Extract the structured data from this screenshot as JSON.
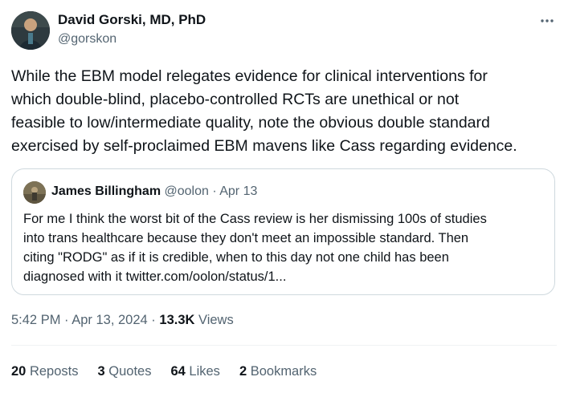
{
  "author": {
    "name": "David Gorski, MD, PhD",
    "handle": "@gorskon"
  },
  "tweet": {
    "lines": [
      "While the EBM model relegates evidence for clinical interventions for",
      "which double-blind, placebo-controlled RCTs are unethical or not",
      "feasible to low/intermediate quality, note the obvious double standard",
      "exercised by self-proclaimed EBM mavens like Cass regarding evidence."
    ]
  },
  "quote": {
    "name": "James Billingham",
    "handle": "@oolon",
    "separator": " · ",
    "date": "Apr 13",
    "lines": [
      "For me I think the worst bit of the Cass review is her dismissing 100s of studies",
      "into trans healthcare because they don't meet an impossible standard. Then",
      "citing \"RODG\" as if it is credible, when to this day not one child has been",
      "diagnosed with it twitter.com/oolon/status/1..."
    ]
  },
  "meta": {
    "time": "5:42 PM",
    "separator": " · ",
    "date": "Apr 13, 2024",
    "views_count": "13.3K",
    "views_label": " Views"
  },
  "stats": {
    "reposts_count": "20",
    "reposts_label": " Reposts",
    "quotes_count": "3",
    "quotes_label": " Quotes",
    "likes_count": "64",
    "likes_label": " Likes",
    "bookmarks_count": "2",
    "bookmarks_label": " Bookmarks"
  },
  "icons": {
    "more": "more-horizontal-icon"
  },
  "colors": {
    "text_primary": "#0f1419",
    "text_secondary": "#536471",
    "border": "#cfd9de"
  }
}
